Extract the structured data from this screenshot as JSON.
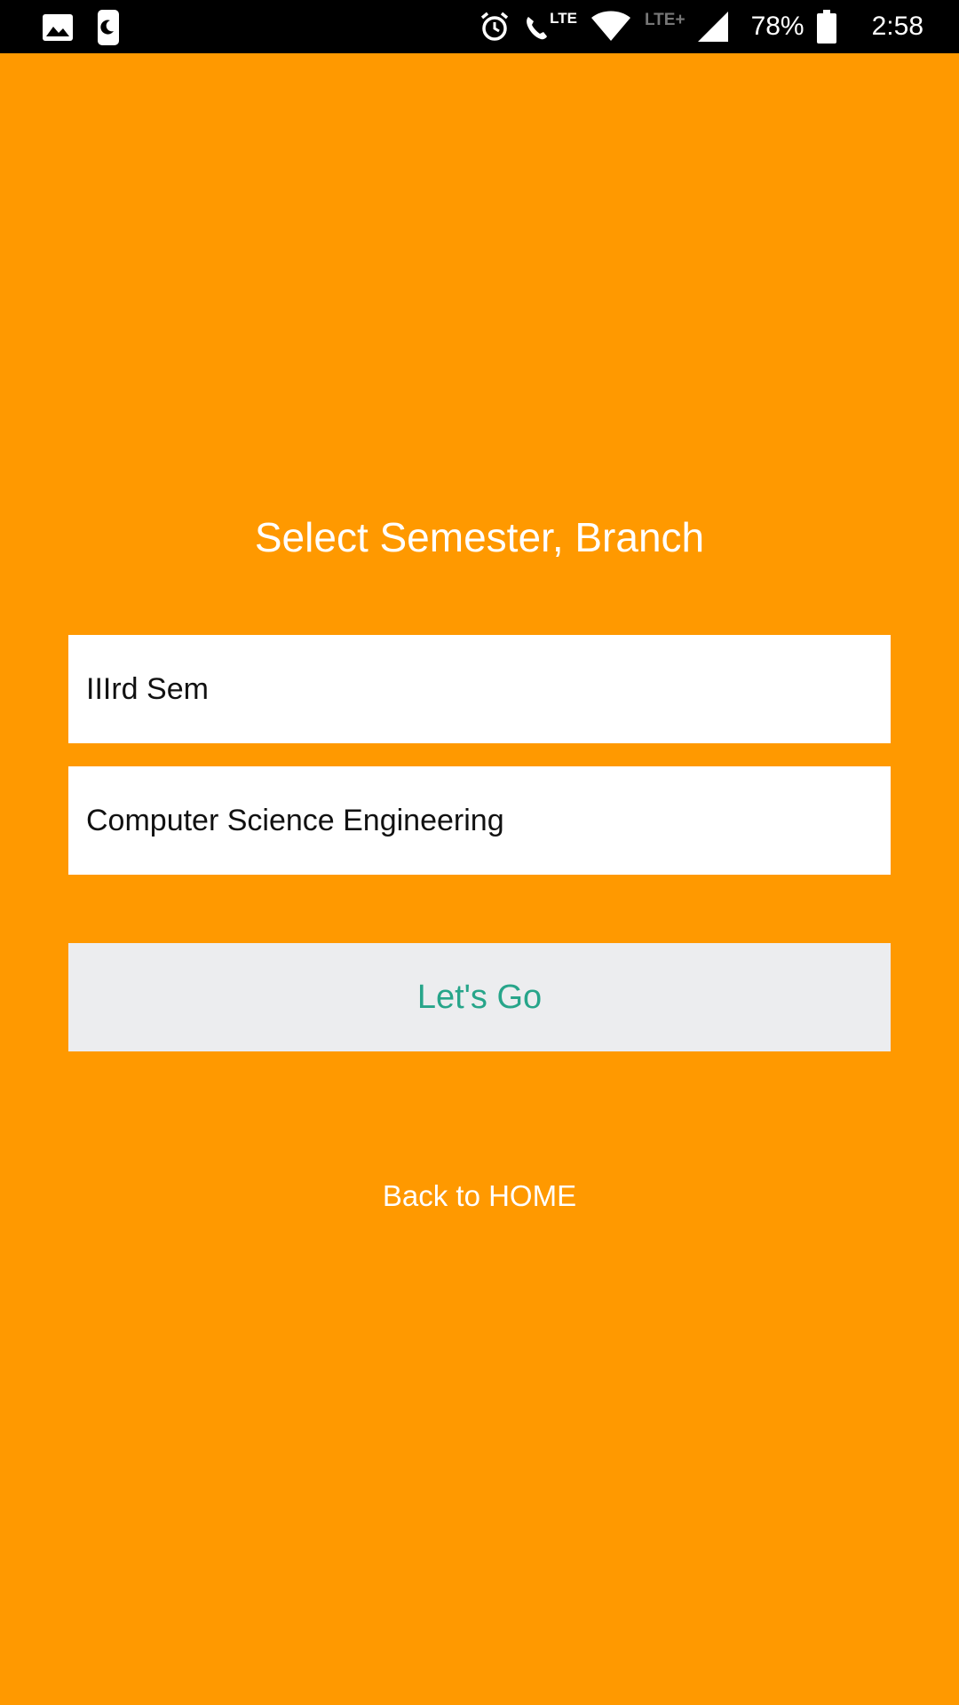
{
  "status_bar": {
    "left_icons": [
      "gallery-icon",
      "do-not-disturb-icon"
    ],
    "right_icons": [
      "alarm-icon",
      "volte-call-icon",
      "wifi-icon",
      "cellular-signal-icon",
      "battery-icon"
    ],
    "call_network_label": "LTE",
    "data_network_label": "LTE+",
    "battery_level": "78%",
    "time": "2:58"
  },
  "colors": {
    "background": "#FF9900",
    "input_background": "#FFFFFF",
    "button_background": "#ECEDEF",
    "button_text": "#27A58A",
    "title_text": "#FFFFFF"
  },
  "form": {
    "title": "Select Semester, Branch",
    "semester_selected": "IIIrd Sem",
    "branch_selected": "Computer Science Engineering",
    "submit_label": "Let's Go",
    "back_label": "Back to HOME"
  }
}
